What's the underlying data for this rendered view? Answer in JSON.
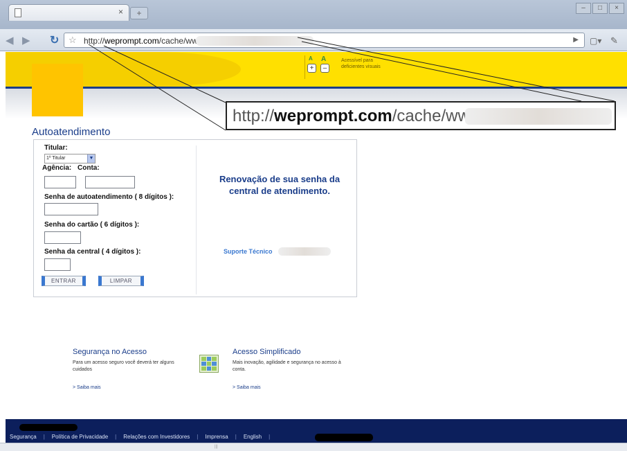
{
  "browser": {
    "tab_close_glyph": "×",
    "new_tab_glyph": "+",
    "window_controls": [
      "–",
      "□",
      "×"
    ],
    "url_prefix": "http://",
    "url_domain": "weprompt.com",
    "url_path": "/cache/www.",
    "go_glyph": "▶",
    "page_menu_glyph": "▾",
    "wrench_glyph": "✎"
  },
  "accessibility": {
    "letter_a_small": "A",
    "letter_a_large": "A",
    "plus": "+",
    "minus": "–",
    "label": "Acessível para deficientes visuais"
  },
  "zoom_callout": {
    "prefix": "http://",
    "domain": "weprompt.com",
    "path": "/cache/www."
  },
  "page": {
    "title": "Autoatendimento"
  },
  "form": {
    "titular_label": "Titular:",
    "titular_value": "1º Titular",
    "agencia_label": "Agência:",
    "conta_label": "Conta:",
    "senha_auto_label": "Senha de autoatendimento ( 8 dígitos ):",
    "senha_cartao_label": "Senha do cartão ( 6 dígitos ):",
    "senha_central_label": "Senha da central ( 4 dígitos ):",
    "entrar_label": "ENTRAR",
    "limpar_label": "LIMPAR"
  },
  "info": {
    "renovacao": "Renovação de sua senha da central de atendimento.",
    "suporte": "Suporte Técnico"
  },
  "promos": [
    {
      "title": "Segurança no Acesso",
      "text": "Para um acesso seguro você deverá ter alguns cuidados",
      "link": "> Saiba mais"
    },
    {
      "title": "Acesso Simplificado",
      "text": "Mais inovação, agilidade e segurança no acesso à conta.",
      "link": "> Saiba mais"
    }
  ],
  "footer": {
    "links": [
      "Segurança",
      "Política de Privacidade",
      "Relações com Investidores",
      "Imprensa",
      "English"
    ],
    "separator": "|"
  },
  "scrollbar_grip": "|||",
  "colors": {
    "brand_yellow": "#ffe000",
    "brand_blue": "#1a3d8a",
    "footer_navy": "#0c1f5c",
    "button_blue": "#3a78d0"
  }
}
